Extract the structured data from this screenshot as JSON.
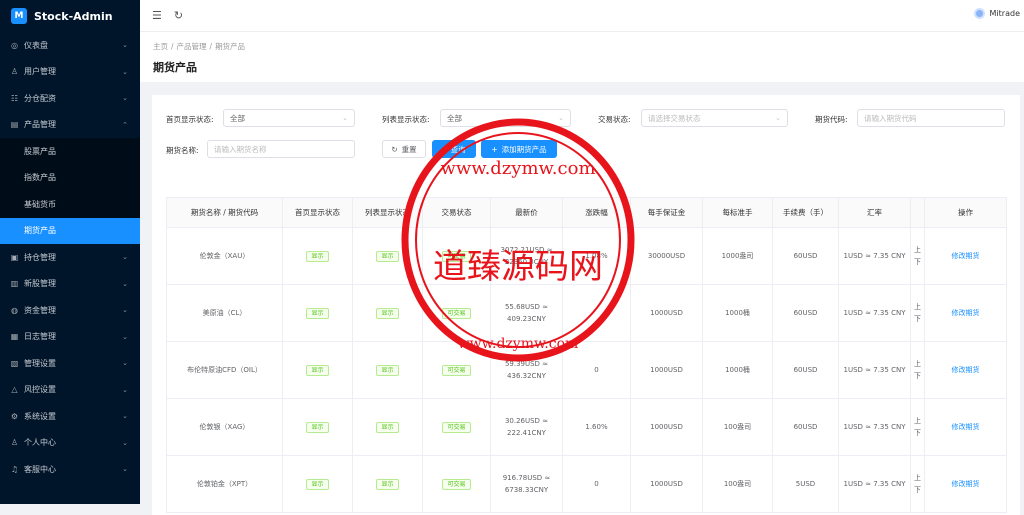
{
  "app": {
    "title": "Stock-Admin",
    "logo_glyph": "M"
  },
  "sidebar": {
    "items": [
      {
        "label": "仪表盘",
        "icon": "dashboard-icon",
        "glyph": "◎"
      },
      {
        "label": "用户管理",
        "icon": "users-icon",
        "glyph": "♙"
      },
      {
        "label": "分仓配资",
        "icon": "split-icon",
        "glyph": "☷"
      },
      {
        "label": "产品管理",
        "icon": "chart-icon",
        "glyph": "▤"
      },
      {
        "label": "持仓管理",
        "icon": "holding-icon",
        "glyph": "▣"
      },
      {
        "label": "新股管理",
        "icon": "newstock-icon",
        "glyph": "▥"
      },
      {
        "label": "资金管理",
        "icon": "money-icon",
        "glyph": "◍"
      },
      {
        "label": "日志管理",
        "icon": "log-icon",
        "glyph": "▦"
      },
      {
        "label": "管理设置",
        "icon": "admin-icon",
        "glyph": "▧"
      },
      {
        "label": "风控设置",
        "icon": "risk-icon",
        "glyph": "△"
      },
      {
        "label": "系统设置",
        "icon": "gear-icon",
        "glyph": "⚙"
      },
      {
        "label": "个人中心",
        "icon": "person-icon",
        "glyph": "♙"
      },
      {
        "label": "客服中心",
        "icon": "headset-icon",
        "glyph": "♫"
      }
    ],
    "sub": [
      "股票产品",
      "指数产品",
      "基础货币",
      "期货产品"
    ]
  },
  "topbar": {
    "user": "Mitrade"
  },
  "breadcrumb": [
    "主页",
    "/",
    "产品管理",
    "/",
    "期货产品"
  ],
  "page_title": "期货产品",
  "filters": {
    "home_label": "首页显示状态:",
    "home_value": "全部",
    "list_label": "列表显示状态:",
    "list_value": "全部",
    "trade_label": "交易状态:",
    "trade_ph": "请选择交易状态",
    "code_label": "期货代码:",
    "code_ph": "请输入期货代码",
    "name_label": "期货名称:",
    "name_ph": "请输入期货名称",
    "reset": "重置",
    "query": "查询",
    "add": "添加期货产品"
  },
  "table": {
    "headers": [
      "期货名称 / 期货代码",
      "首页显示状态",
      "列表显示状态",
      "交易状态",
      "最新价",
      "涨跌幅",
      "每手保证金",
      "每标准手",
      "手续费（手）",
      "汇率",
      "",
      "操作"
    ],
    "rows": [
      [
        "伦敦金（XAU）",
        "显示",
        "显示",
        "可交易",
        "3072.21USD ≈ 22360.3CNY",
        "1.08%",
        "30000USD",
        "1000盎司",
        "60USD",
        "1USD ≈ 7.35 CNY",
        "上 下",
        "修改期货"
      ],
      [
        "美原油（CL）",
        "显示",
        "显示",
        "可交易",
        "55.68USD ≈ 409.23CNY",
        "",
        "1000USD",
        "1000桶",
        "60USD",
        "1USD ≈ 7.35 CNY",
        "上 下",
        "修改期货"
      ],
      [
        "布伦特原油CFD（OIL）",
        "显示",
        "显示",
        "可交易",
        "59.39USD ≈ 436.32CNY",
        "0",
        "1000USD",
        "1000桶",
        "60USD",
        "1USD ≈ 7.35 CNY",
        "上 下",
        "修改期货"
      ],
      [
        "伦敦银（XAG）",
        "显示",
        "显示",
        "可交易",
        "30.26USD ≈ 222.41CNY",
        "1.60%",
        "1000USD",
        "100盎司",
        "60USD",
        "1USD ≈ 7.35 CNY",
        "上 下",
        "修改期货"
      ],
      [
        "伦敦铂金（XPT）",
        "显示",
        "显示",
        "可交易",
        "916.78USD ≈ 6738.33CNY",
        "0",
        "1000USD",
        "100盎司",
        "5USD",
        "1USD ≈ 7.35 CNY",
        "上 下",
        "修改期货"
      ]
    ]
  },
  "watermark": {
    "text": "道臻源码网",
    "url": "www.dzymw.com",
    "color": "#e8141c"
  }
}
